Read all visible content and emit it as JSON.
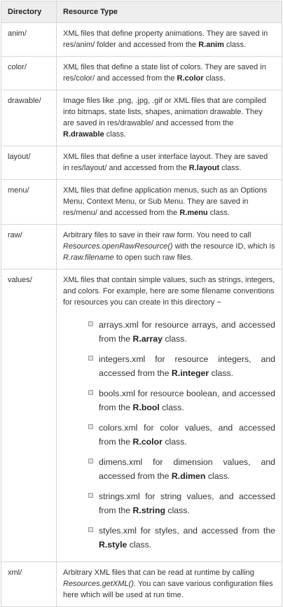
{
  "table": {
    "headers": {
      "directory": "Directory",
      "resource_type": "Resource Type"
    },
    "rows": [
      {
        "dir": "anim/",
        "parts": [
          "XML files that define property animations. They are saved in res/anim/ folder and accessed from the ",
          "R.anim",
          " class."
        ]
      },
      {
        "dir": "color/",
        "parts": [
          "XML files that define a state list of colors. They are saved in res/color/ and accessed from the ",
          "R.color",
          " class."
        ]
      },
      {
        "dir": "drawable/",
        "parts": [
          "Image files like .png, .jpg, .gif or XML files that are compiled into bitmaps, state lists, shapes, animation drawable. They are saved in res/drawable/ and accessed from the ",
          "R.drawable",
          " class."
        ]
      },
      {
        "dir": "layout/",
        "parts": [
          "XML files that define a user interface layout. They are saved in res/layout/ and accessed from the ",
          "R.layout",
          " class."
        ]
      },
      {
        "dir": "menu/",
        "parts": [
          "XML files that define application menus, such as an Options Menu, Context Menu, or Sub Menu. They are saved in res/menu/ and accessed from the ",
          "R.menu",
          " class."
        ]
      },
      {
        "dir": "raw/",
        "parts": [
          "Arbitrary files to save in their raw form. You need to call ",
          "Resources.openRawResource()",
          " with the resource ID, which is ",
          "R.raw.filename",
          " to open such raw files."
        ]
      },
      {
        "dir": "values/",
        "intro": "XML files that contain simple values, such as strings, integers, and colors. For example, here are some filename conventions for resources you can create in this directory −",
        "items": [
          {
            "parts": [
              "arrays.xml for resource arrays, and accessed from the ",
              "R.array",
              " class."
            ]
          },
          {
            "parts": [
              "integers.xml for resource integers, and accessed from the ",
              "R.integer",
              " class."
            ]
          },
          {
            "parts": [
              "bools.xml for resource boolean, and accessed from the ",
              "R.bool",
              " class."
            ]
          },
          {
            "parts": [
              "colors.xml for color values, and accessed from the ",
              "R.color",
              " class."
            ]
          },
          {
            "parts": [
              "dimens.xml for dimension values, and accessed from the ",
              "R.dimen",
              " class."
            ]
          },
          {
            "parts": [
              "strings.xml for string values, and accessed from the ",
              "R.string",
              " class."
            ]
          },
          {
            "parts": [
              "styles.xml for styles, and accessed from the ",
              "R.style",
              " class."
            ]
          }
        ]
      },
      {
        "dir": "xml/",
        "parts": [
          "Arbitrary XML files that can be read at runtime by calling ",
          "Resources.getXML()",
          ". You can save various configuration files here which will be used at run time."
        ]
      }
    ]
  }
}
